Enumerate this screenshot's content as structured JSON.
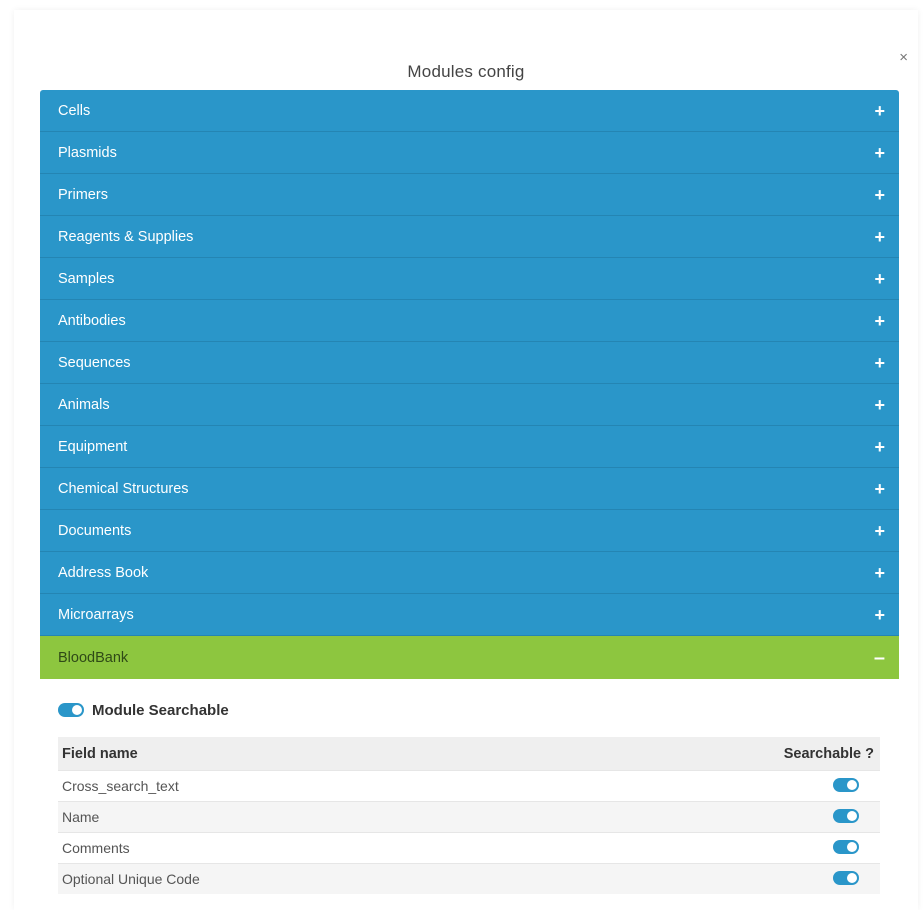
{
  "modal": {
    "title": "Modules config",
    "close_label": "×"
  },
  "modules": [
    {
      "label": "Cells",
      "sign": "+"
    },
    {
      "label": "Plasmids",
      "sign": "+"
    },
    {
      "label": "Primers",
      "sign": "+"
    },
    {
      "label": "Reagents & Supplies",
      "sign": "+"
    },
    {
      "label": "Samples",
      "sign": "+"
    },
    {
      "label": "Antibodies",
      "sign": "+"
    },
    {
      "label": "Sequences",
      "sign": "+"
    },
    {
      "label": "Animals",
      "sign": "+"
    },
    {
      "label": "Equipment",
      "sign": "+"
    },
    {
      "label": "Chemical Structures",
      "sign": "+"
    },
    {
      "label": "Documents",
      "sign": "+"
    },
    {
      "label": "Address Book",
      "sign": "+"
    },
    {
      "label": "Microarrays",
      "sign": "+"
    }
  ],
  "active_module": {
    "label": "BloodBank",
    "sign": "–",
    "searchable_label": "Module Searchable",
    "searchable": true,
    "columns": {
      "field": "Field name",
      "searchable": "Searchable ?"
    },
    "fields": [
      {
        "name": "Cross_search_text",
        "searchable": true
      },
      {
        "name": "Name",
        "searchable": true
      },
      {
        "name": "Comments",
        "searchable": true
      },
      {
        "name": "Optional Unique Code",
        "searchable": true
      }
    ]
  },
  "colors": {
    "module_header": "#2a96c9",
    "active_header": "#8dc63f",
    "toggle_on": "#2a96c9"
  }
}
